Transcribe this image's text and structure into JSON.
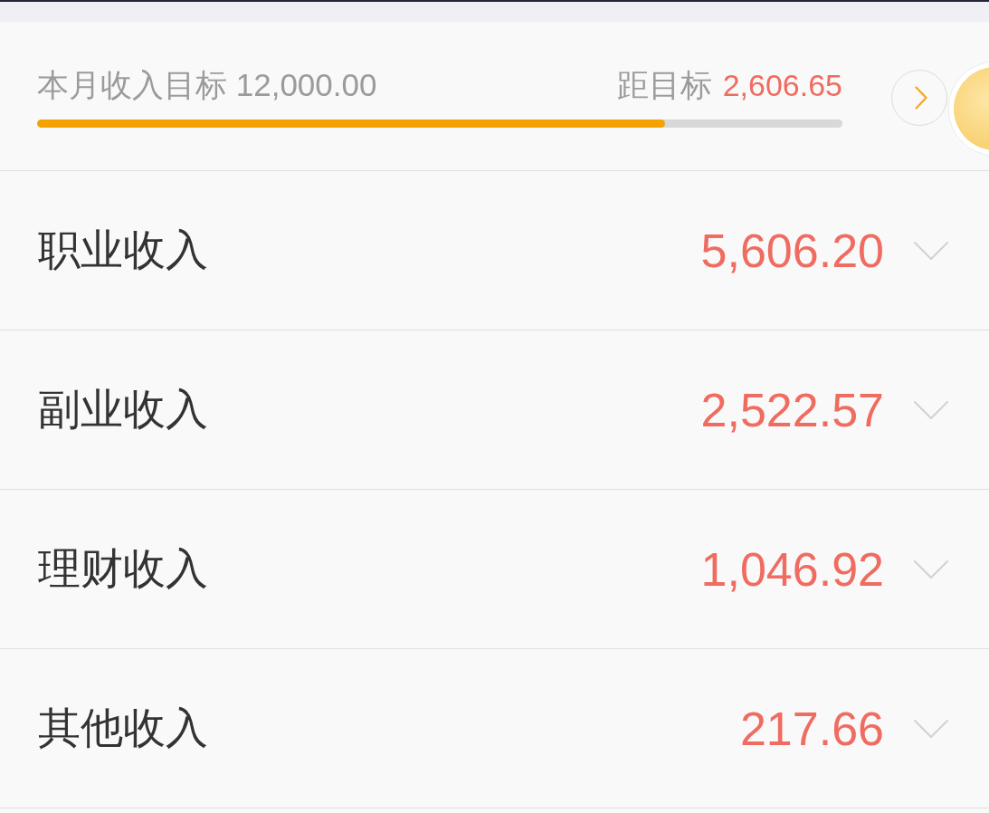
{
  "goal": {
    "label": "本月收入目标 12,000.00",
    "remaining_label": "距目标",
    "remaining_value": "2,606.65",
    "level": 0.78
  },
  "categories": [
    {
      "name": "职业收入",
      "amount": "5,606.20",
      "expanded": false
    },
    {
      "name": "副业收入",
      "amount": "2,522.57",
      "expanded": false
    },
    {
      "name": "理财收入",
      "amount": "1,046.92",
      "expanded": false
    },
    {
      "name": "其他收入",
      "amount": "217.66",
      "expanded": false
    }
  ]
}
